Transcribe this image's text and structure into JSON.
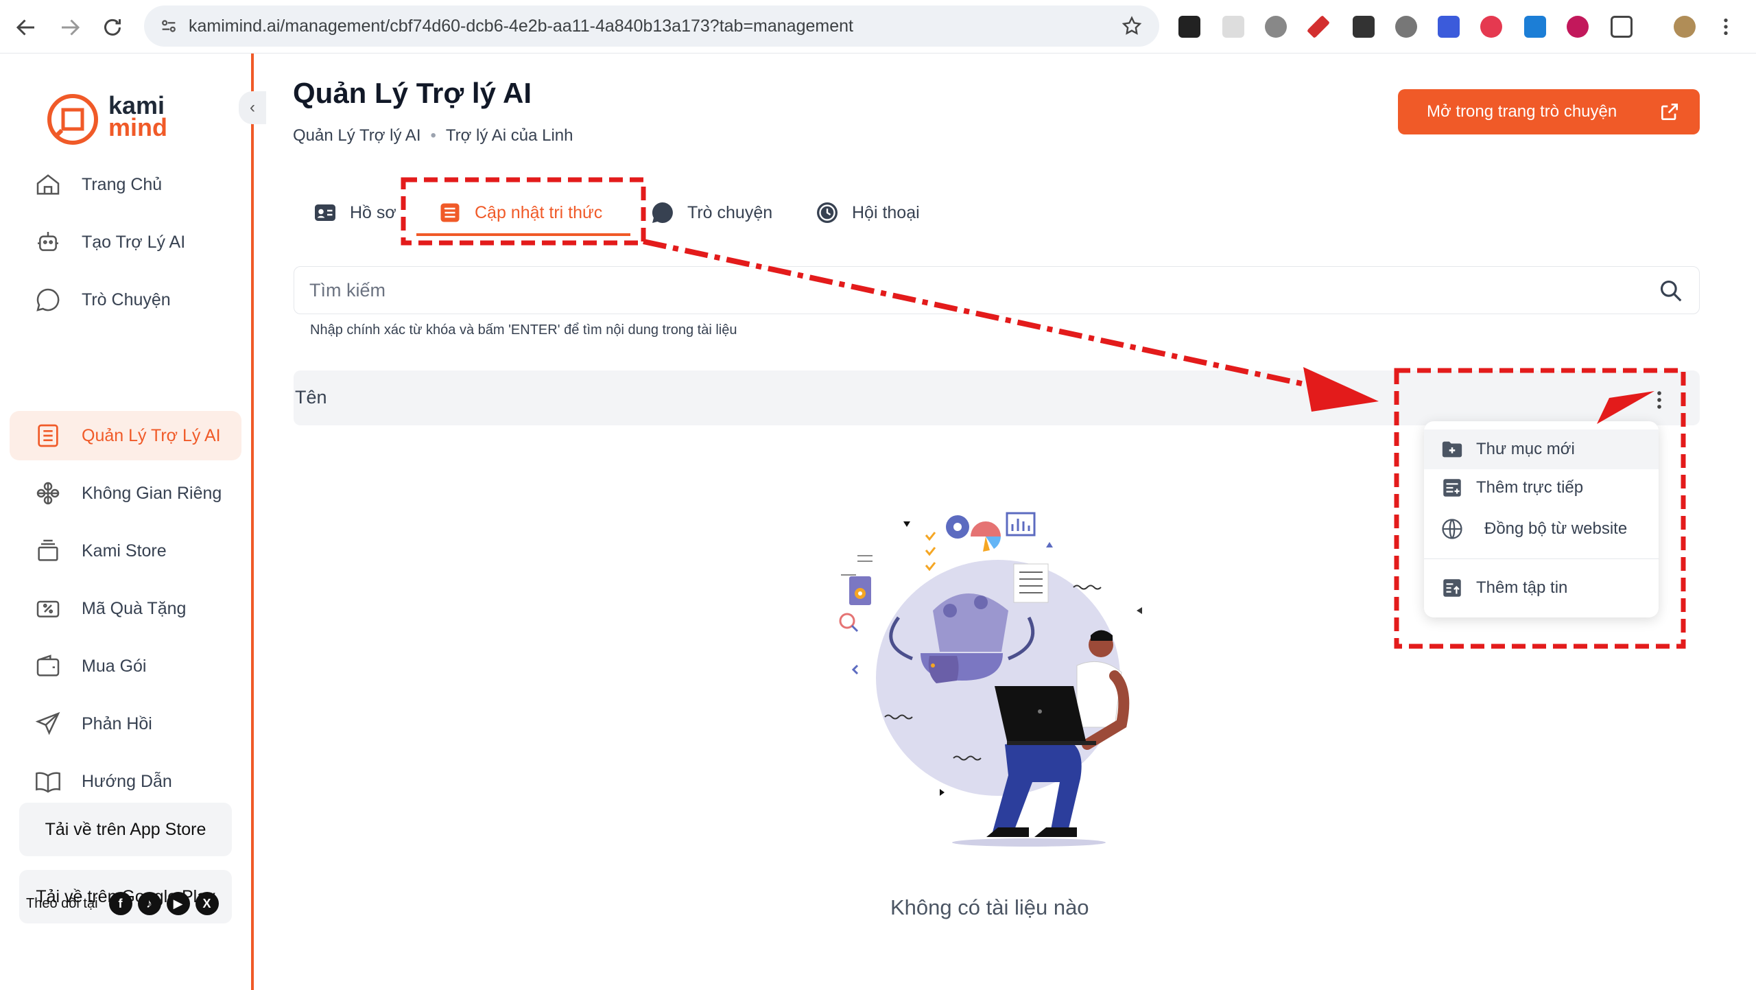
{
  "browser": {
    "url": "kamimind.ai/management/cbf74d60-dcb6-4e2b-aa11-4a840b13a173?tab=management"
  },
  "brand": {
    "name_top": "kami",
    "name_bottom": "mind",
    "accent": "#f05a28"
  },
  "sidebar": {
    "items": [
      {
        "label": "Trang Chủ",
        "icon": "home-icon"
      },
      {
        "label": "Tạo Trợ Lý AI",
        "icon": "bot-icon"
      },
      {
        "label": "Trò Chuyện",
        "icon": "chat-icon"
      },
      {
        "label": "Quản Lý Trợ Lý AI",
        "icon": "list-icon",
        "active": true
      },
      {
        "label": "Không Gian Riêng",
        "icon": "workspace-icon"
      },
      {
        "label": "Kami Store",
        "icon": "store-icon"
      },
      {
        "label": "Mã Quà Tặng",
        "icon": "coupon-icon"
      },
      {
        "label": "Mua Gói",
        "icon": "wallet-icon"
      },
      {
        "label": "Phản Hồi",
        "icon": "send-icon"
      },
      {
        "label": "Hướng Dẫn",
        "icon": "book-icon"
      }
    ],
    "app_store": "Tải về trên App Store",
    "google_play": "Tải về trên Google Play",
    "follow": "Theo dõi tại"
  },
  "main": {
    "title": "Quản Lý Trợ lý AI",
    "breadcrumb": [
      "Quản Lý Trợ lý AI",
      "Trợ lý Ai của Linh"
    ],
    "open_button": "Mở trong trang trò chuyện",
    "tabs": [
      {
        "label": "Hồ sơ",
        "icon": "profile-icon"
      },
      {
        "label": "Cập nhật tri thức",
        "icon": "knowledge-icon",
        "active": true
      },
      {
        "label": "Trò chuyện",
        "icon": "chat-bubble-icon"
      },
      {
        "label": "Hội thoại",
        "icon": "history-icon"
      }
    ],
    "search": {
      "placeholder": "Tìm kiếm",
      "hint": "Nhập chính xác từ khóa và bấm 'ENTER' để tìm nội dung trong tài liệu"
    },
    "table": {
      "column": "Tên"
    },
    "dropdown": [
      {
        "label": "Thư mục mới",
        "icon": "folder-plus-icon"
      },
      {
        "label": "Thêm trực tiếp",
        "icon": "add-text-icon"
      },
      {
        "label": "Đồng bộ từ website",
        "icon": "globe-icon"
      },
      {
        "label": "Thêm tập tin",
        "icon": "file-upload-icon"
      }
    ],
    "empty": "Không có tài liệu nào"
  }
}
